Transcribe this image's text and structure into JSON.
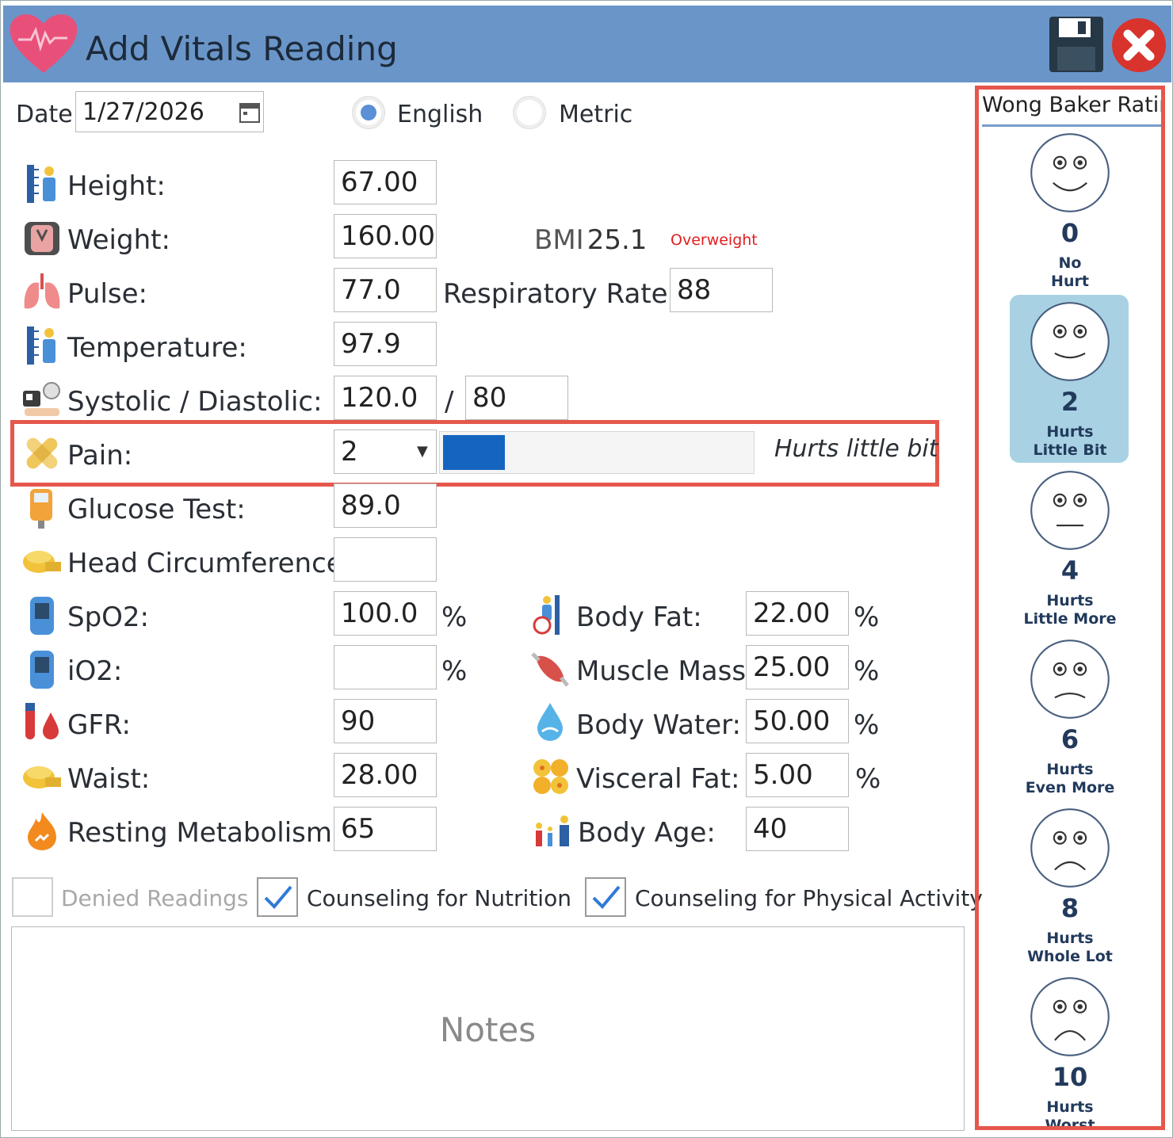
{
  "window": {
    "title": "Add Vitals Reading"
  },
  "date": {
    "label": "Date:",
    "value": "1/27/2026"
  },
  "units": {
    "english": "English",
    "metric": "Metric",
    "selected": "English"
  },
  "vitals": {
    "height": {
      "label": "Height:",
      "value": "67.00"
    },
    "weight": {
      "label": "Weight:",
      "value": "160.00"
    },
    "bmi": {
      "label": "BMI",
      "value": "25.1",
      "status": "Overweight"
    },
    "pulse": {
      "label": "Pulse:",
      "value": "77.0"
    },
    "respiratory": {
      "label": "Respiratory Rate:",
      "value": "88"
    },
    "temperature": {
      "label": "Temperature:",
      "value": "97.9"
    },
    "bp": {
      "label": "Systolic / Diastolic:",
      "systolic": "120.0",
      "sep": "/",
      "diastolic": "80"
    },
    "pain": {
      "label": "Pain:",
      "value": "2",
      "level": 0.2,
      "description": "Hurts little bit"
    },
    "glucose": {
      "label": "Glucose Test:",
      "value": "89.0"
    },
    "head": {
      "label": "Head Circumference:",
      "value": ""
    },
    "spo2": {
      "label": "SpO2:",
      "value": "100.0",
      "unit": "%"
    },
    "io2": {
      "label": "iO2:",
      "value": "",
      "unit": "%"
    },
    "gfr": {
      "label": "GFR:",
      "value": "90"
    },
    "waist": {
      "label": "Waist:",
      "value": "28.00"
    },
    "rmr": {
      "label": "Resting Metabolism:",
      "value": "65"
    },
    "bodyfat": {
      "label": "Body Fat:",
      "value": "22.00",
      "unit": "%"
    },
    "muscle": {
      "label": "Muscle Mass:",
      "value": "25.00",
      "unit": "%"
    },
    "water": {
      "label": "Body Water:",
      "value": "50.00",
      "unit": "%"
    },
    "visceral": {
      "label": "Visceral Fat:",
      "value": "5.00",
      "unit": "%"
    },
    "bodyage": {
      "label": "Body Age:",
      "value": "40"
    }
  },
  "checks": {
    "denied": {
      "label": "Denied Readings",
      "checked": false
    },
    "nutrition": {
      "label": "Counseling for Nutrition",
      "checked": true
    },
    "activity": {
      "label": "Counseling for Physical Activity",
      "checked": true
    }
  },
  "notes": {
    "placeholder": "Notes"
  },
  "wong_baker": {
    "title": "Wong Baker Rating",
    "selected": "2",
    "faces": [
      {
        "num": "0",
        "l1": "No",
        "l2": "Hurt"
      },
      {
        "num": "2",
        "l1": "Hurts",
        "l2": "Little Bit"
      },
      {
        "num": "4",
        "l1": "Hurts",
        "l2": "Little More"
      },
      {
        "num": "6",
        "l1": "Hurts",
        "l2": "Even More"
      },
      {
        "num": "8",
        "l1": "Hurts",
        "l2": "Whole Lot"
      },
      {
        "num": "10",
        "l1": "Hurts",
        "l2": "Worst"
      }
    ]
  },
  "colors": {
    "titlebar": "#6a95c8",
    "accent": "#1565c0",
    "highlight": "#e5574c",
    "selected_face": "#a8d2e3",
    "bmi_status": "#e02020"
  }
}
